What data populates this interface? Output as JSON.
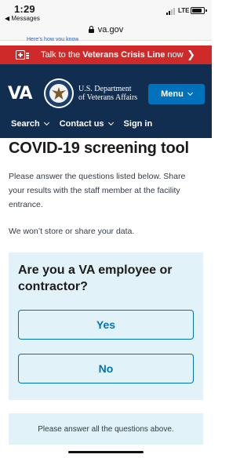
{
  "status_bar": {
    "time": "1:29",
    "back_label": "◀ Messages",
    "network": "LTE"
  },
  "browser": {
    "url": "va.gov",
    "cut_link_text": "Here’s how you know"
  },
  "crisis_banner": {
    "prefix": "Talk to the ",
    "emphasis": "Veterans Crisis Line",
    "suffix": " now",
    "chevron": "❯",
    "color": "#cf2a2a"
  },
  "header": {
    "logo": "VA",
    "dept_line1": "U.S. Department",
    "dept_line2": "of Veterans Affairs",
    "menu_label": "Menu",
    "nav": [
      {
        "label": "Search"
      },
      {
        "label": "Contact us"
      },
      {
        "label": "Sign in"
      }
    ],
    "color": "#112e51",
    "accent": "#0071bb"
  },
  "page": {
    "title": "COVID-19 screening tool",
    "intro": "Please answer the questions listed below. Share your results with the staff member at the facility entrance.",
    "privacy": "We won’t store or share your data.",
    "question": "Are you a VA employee or contractor?",
    "answers": [
      "Yes",
      "No"
    ],
    "result_message": "Please answer all the questions above.",
    "card_color": "#e1f3f8"
  }
}
